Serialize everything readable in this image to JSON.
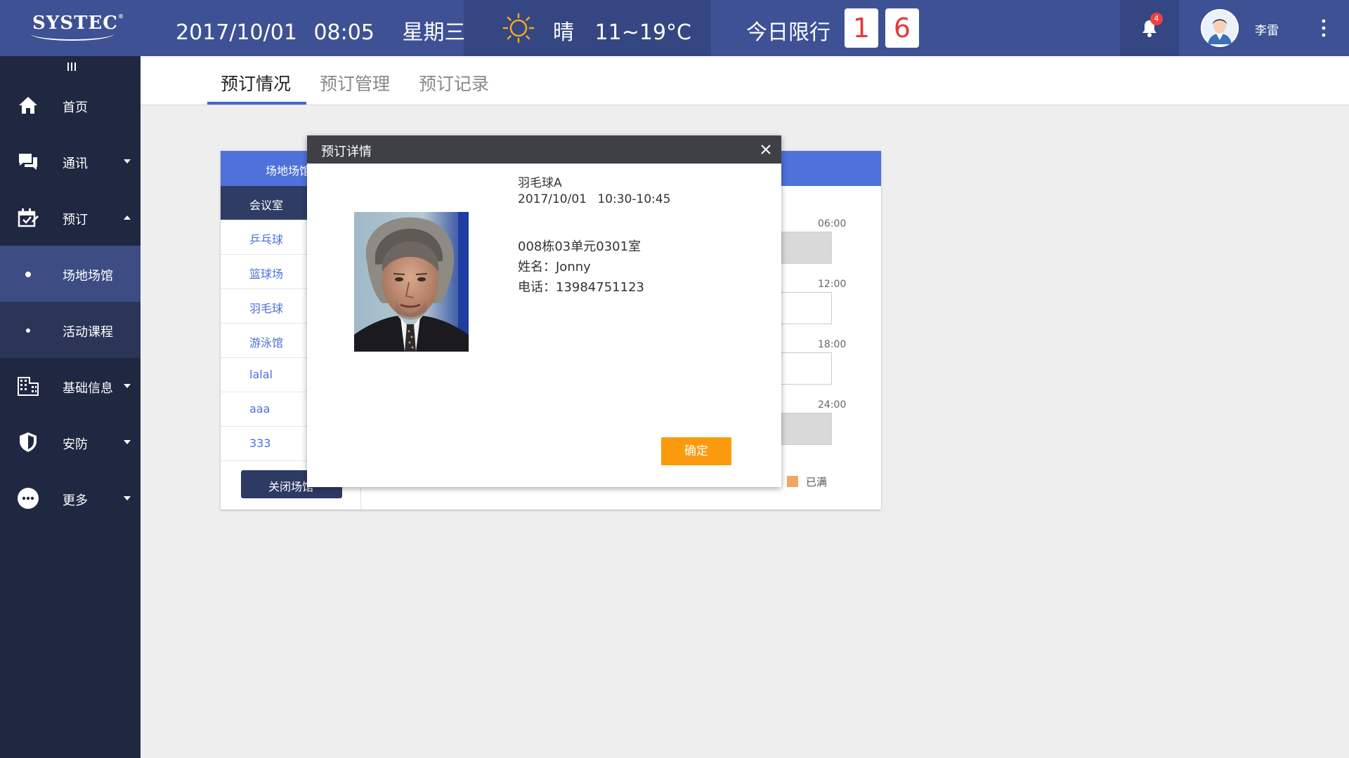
{
  "header": {
    "logo": "SYSTEC",
    "logo_mark": "®",
    "date": "2017/10/01",
    "time": "08:05",
    "weekday": "星期三",
    "weather": "晴",
    "temperature": "11~19°C",
    "limit_label": "今日限行",
    "limit_digits": [
      "1",
      "6"
    ],
    "notification_count": "4",
    "user_name": "李雷"
  },
  "sidebar": {
    "items": [
      {
        "label": "首页",
        "icon": "home-icon"
      },
      {
        "label": "通讯",
        "icon": "chat-icon",
        "expandable": true
      },
      {
        "label": "预订",
        "icon": "booking-icon",
        "expanded": true
      },
      {
        "label": "场地场馆",
        "sub": true,
        "active": true
      },
      {
        "label": "活动课程",
        "sub": true
      },
      {
        "label": "基础信息",
        "icon": "building-icon",
        "expandable": true
      },
      {
        "label": "安防",
        "icon": "shield-icon",
        "expandable": true
      },
      {
        "label": "更多",
        "icon": "more-icon",
        "expandable": true
      }
    ]
  },
  "tabs": [
    {
      "label": "预订情况",
      "active": true
    },
    {
      "label": "预订管理"
    },
    {
      "label": "预订记录"
    }
  ],
  "venue_panel": {
    "title": "场地场馆",
    "categories": [
      "会议室",
      "乒乓球",
      "篮球场",
      "羽毛球",
      "游泳馆",
      "lalal",
      "aaa",
      "333"
    ],
    "active_category": "会议室",
    "close_button": "关闭场馆",
    "time_labels": [
      "06:00",
      "12:00",
      "18:00",
      "24:00"
    ],
    "legend_full": "已满",
    "legend_color": "#f0a960"
  },
  "modal": {
    "title": "预订详情",
    "venue": "羽毛球A",
    "date": "2017/10/01",
    "time_range": "10:30-10:45",
    "address": "008栋03单元0301室",
    "name_line": "姓名：Jonny",
    "phone_line": "电话：13984751123",
    "confirm_label": "确定"
  },
  "colors": {
    "topbar": "#3e5195",
    "sidebar": "#1f2741",
    "accent_blue": "#4e72d9",
    "confirm_orange": "#fb9a0e",
    "plate_red": "#e23b3b"
  }
}
